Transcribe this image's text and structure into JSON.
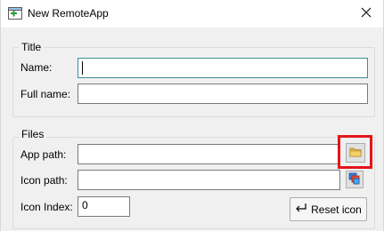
{
  "window": {
    "title": "New RemoteApp",
    "app_icon": "remoteapp-icon",
    "close_icon": "close-icon"
  },
  "title_group": {
    "legend": "Title",
    "name_label": "Name:",
    "name_value": "",
    "fullname_label": "Full name:",
    "fullname_value": ""
  },
  "files_group": {
    "legend": "Files",
    "app_path_label": "App path:",
    "app_path_value": "",
    "app_path_browse_icon": "folder-icon",
    "icon_path_label": "Icon path:",
    "icon_path_value": "",
    "icon_path_browse_icon": "icon-picker-icon",
    "icon_index_label": "Icon Index:",
    "icon_index_value": "0",
    "reset_button_label": "Reset icon",
    "reset_icon": "return-arrow-icon"
  },
  "colors": {
    "highlight": "#e4141b",
    "focus_border": "#3c8e95"
  }
}
